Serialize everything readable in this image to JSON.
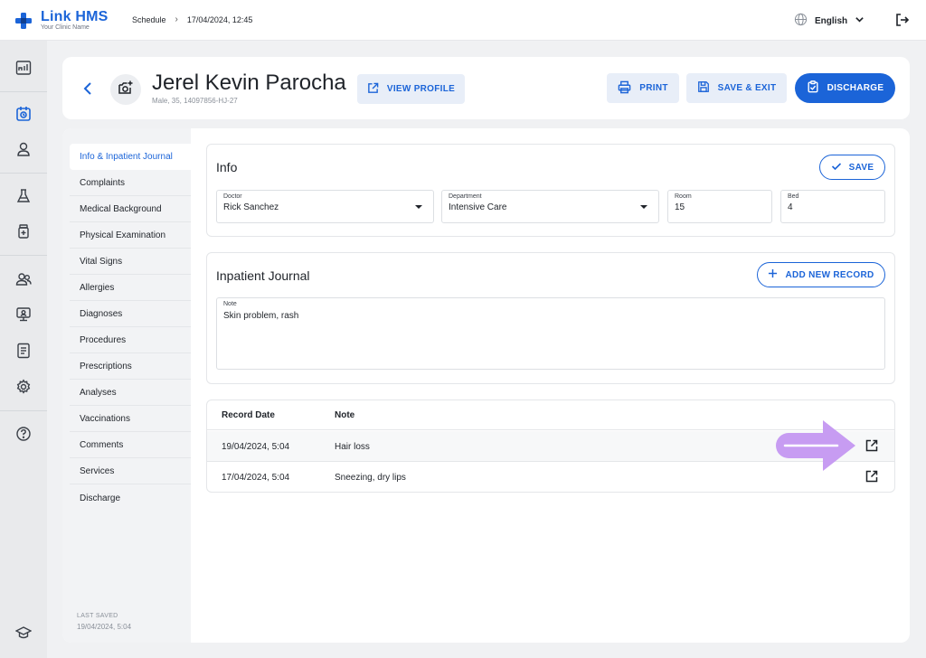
{
  "app": {
    "name": "Link HMS",
    "subtitle": "Your Clinic Name"
  },
  "breadcrumb": {
    "section": "Schedule",
    "separator": "›",
    "current": "17/04/2024, 12:45"
  },
  "language": {
    "label": "English"
  },
  "patient": {
    "name": "Jerel Kevin Parocha",
    "meta": "Male, 35, 14097856-HJ-27"
  },
  "actions": {
    "view_profile": "VIEW PROFILE",
    "print": "PRINT",
    "save_exit": "SAVE & EXIT",
    "discharge": "DISCHARGE"
  },
  "nav": {
    "items": [
      "Info & Inpatient Journal",
      "Complaints",
      "Medical Background",
      "Physical Examination",
      "Vital Signs",
      "Allergies",
      "Diagnoses",
      "Procedures",
      "Prescriptions",
      "Analyses",
      "Vaccinations",
      "Comments",
      "Services",
      "Discharge"
    ],
    "active_index": 0,
    "last_saved_label": "LAST SAVED",
    "last_saved_value": "19/04/2024, 5:04"
  },
  "info": {
    "title": "Info",
    "save_label": "SAVE",
    "doctor": {
      "label": "Doctor",
      "value": "Rick Sanchez"
    },
    "department": {
      "label": "Department",
      "value": "Intensive Care"
    },
    "room": {
      "label": "Room",
      "value": "15"
    },
    "bed": {
      "label": "Bed",
      "value": "4"
    }
  },
  "journal": {
    "title": "Inpatient Journal",
    "add_label": "ADD NEW RECORD",
    "note": {
      "label": "Note",
      "value": "Skin problem, rash"
    }
  },
  "records": {
    "columns": [
      "Record Date",
      "Note"
    ],
    "rows": [
      {
        "date": "19/04/2024, 5:04",
        "note": "Hair loss"
      },
      {
        "date": "17/04/2024, 5:04",
        "note": "Sneezing, dry lips"
      }
    ]
  },
  "colors": {
    "accent": "#1b64d8",
    "hint_arrow": "#c79cf2"
  }
}
